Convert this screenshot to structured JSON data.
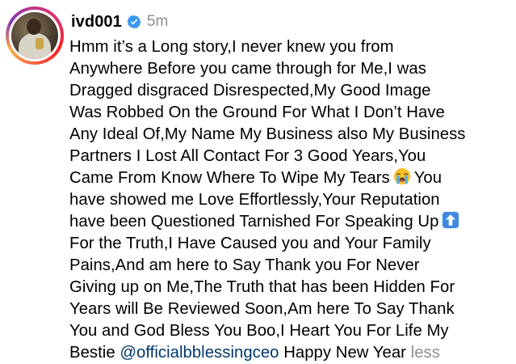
{
  "post": {
    "username": "ivd001",
    "timestamp": "5m",
    "avatar_icon": "profile-photo-story-ring",
    "verified_icon": "verified-badge-icon",
    "verified_color": "#3897f0",
    "caption_lines": [
      "Hmm it’s a Long story,I never knew you from",
      "Anywhere Before you came through for Me,I was",
      "Dragged disgraced Disrespected,My Good Image",
      "Was Robbed On the Ground For What I Don’t Have",
      "Any Ideal Of,My Name My Business also My Business",
      "Partners I Lost All Contact For 3 Good Years,You",
      "Came From Know Where To Wipe My Tears",
      "You",
      "have showed me Love  Effortlessly,Your Reputation",
      "have been Questioned Tarnished For Speaking Up",
      "For the Truth,I Have Caused you and Your Family",
      "Pains,And am here to Say Thank you For Never",
      "Giving up on Me,The Truth that has been Hidden For",
      "Years will Be Reviewed Soon,Am here To Say Thank",
      "You and God Bless You Boo,I Heart You For Life My",
      "Bestie",
      "@officialbblessingceo",
      "Happy New Year",
      "less"
    ],
    "emojis": {
      "crying": "crying-face-icon",
      "up_arrow": "up-arrow-button-icon"
    },
    "colors": {
      "mention": "#00376b",
      "muted": "#8e8e8e"
    }
  }
}
